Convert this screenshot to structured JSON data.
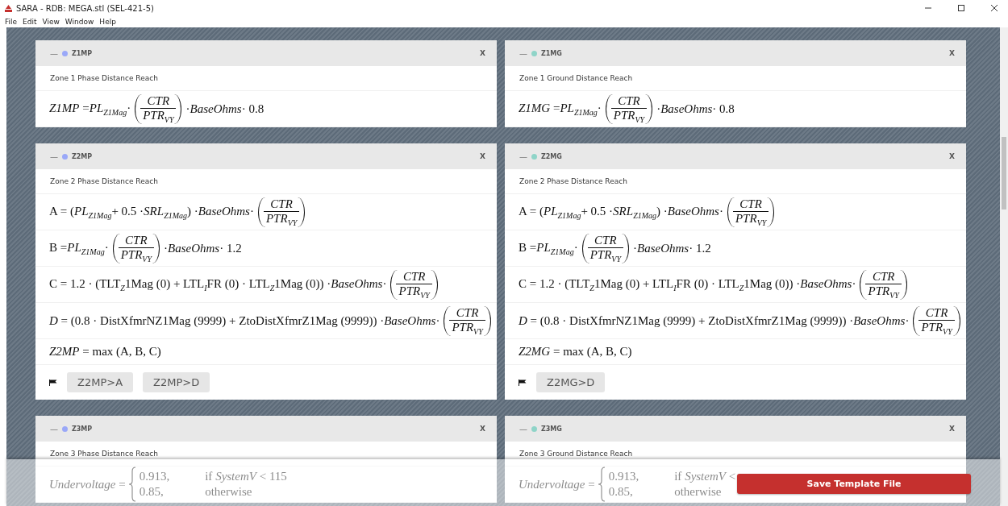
{
  "window": {
    "title": "SARA - RDB: MEGA.stl (SEL-421-5)"
  },
  "menu": [
    "File",
    "Edit",
    "View",
    "Window",
    "Help"
  ],
  "cards": [
    {
      "collapse": "—",
      "title": "Z1MP",
      "color": "#9aa8f8",
      "close": "X",
      "description": "Zone 1 Phase Distance Reach",
      "formulas": [
        [
          {
            "kind": "text",
            "text": "*Z1MP* =*PL*$_{Z1Mag}$·"
          },
          {
            "kind": "fraction",
            "num": "CTR",
            "den": "PTR$_{VY}$"
          },
          {
            "kind": "text",
            "text": "·*BaseOhms*· 0.8"
          }
        ]
      ]
    },
    {
      "collapse": "—",
      "title": "Z1MG",
      "color": "#8fd4c8",
      "close": "X",
      "description": "Zone 1 Ground Distance Reach",
      "formulas": [
        [
          {
            "kind": "text",
            "text": "*Z1MG* =*PL*$_{Z1Mag}$·"
          },
          {
            "kind": "fraction",
            "num": "CTR",
            "den": "PTR$_{VY}$"
          },
          {
            "kind": "text",
            "text": "·*BaseOhms*· 0.8"
          }
        ]
      ]
    },
    {
      "collapse": "—",
      "title": "Z2MP",
      "color": "#9aa8f8",
      "close": "X",
      "description": "Zone 2 Phase Distance Reach",
      "formulas": [
        [
          {
            "kind": "text",
            "text": "A = (*PL*$_{Z1Mag}$+ 0.5 ·*SRL*$_{Z1Mag}$) ·*BaseOhms*·"
          },
          {
            "kind": "fraction",
            "num": "CTR",
            "den": "PTR$_{VY}$"
          }
        ],
        [
          {
            "kind": "text",
            "text": "B =*PL*$_{Z1Mag}$·"
          },
          {
            "kind": "fraction",
            "num": "CTR",
            "den": "PTR$_{VY}$"
          },
          {
            "kind": "text",
            "text": "·*BaseOhms*· 1.2"
          }
        ],
        [
          {
            "kind": "text",
            "text": "C = 1.2 · (TLT$_{Z}$1Mag (0) + LTL$_{I}$FR (0) · LTL$_{Z}$1Mag (0)) ·*BaseOhms*·"
          },
          {
            "kind": "fraction",
            "num": "CTR",
            "den": "PTR$_{VY}$"
          }
        ],
        [
          {
            "kind": "text",
            "text": "*D* = (0.8 · DistXfmrNZ1Mag (9999) + ZtoDistXfmrZ1Mag (9999)) ·*BaseOhms*·"
          },
          {
            "kind": "fraction",
            "num": "CTR",
            "den": "PTR$_{VY}$"
          }
        ],
        [
          {
            "kind": "text",
            "text": "*Z2MP* = max (A, B, C)"
          }
        ]
      ],
      "flags": [
        "Z2MP>A",
        "Z2MP>D"
      ]
    },
    {
      "collapse": "—",
      "title": "Z2MG",
      "color": "#8fd4c8",
      "close": "X",
      "description": "Zone 2 Phase Distance Reach",
      "formulas": [
        [
          {
            "kind": "text",
            "text": "A = (*PL*$_{Z1Mag}$+ 0.5 ·*SRL*$_{Z1Mag}$) ·*BaseOhms*·"
          },
          {
            "kind": "fraction",
            "num": "CTR",
            "den": "PTR$_{VY}$"
          }
        ],
        [
          {
            "kind": "text",
            "text": "B =*PL*$_{Z1Mag}$·"
          },
          {
            "kind": "fraction",
            "num": "CTR",
            "den": "PTR$_{VY}$"
          },
          {
            "kind": "text",
            "text": "·*BaseOhms*· 1.2"
          }
        ],
        [
          {
            "kind": "text",
            "text": "C = 1.2 · (TLT$_{Z}$1Mag (0) + LTL$_{I}$FR (0) · LTL$_{Z}$1Mag (0)) ·*BaseOhms*·"
          },
          {
            "kind": "fraction",
            "num": "CTR",
            "den": "PTR$_{VY}$"
          }
        ],
        [
          {
            "kind": "text",
            "text": "*D* = (0.8 · DistXfmrNZ1Mag (9999) + ZtoDistXfmrZ1Mag (9999)) ·*BaseOhms*·"
          },
          {
            "kind": "fraction",
            "num": "CTR",
            "den": "PTR$_{VY}$"
          }
        ],
        [
          {
            "kind": "text",
            "text": "*Z2MG* = max (A, B, C)"
          }
        ]
      ],
      "flags": [
        "Z2MG>D"
      ]
    },
    {
      "collapse": "—",
      "title": "Z3MP",
      "color": "#9aa8f8",
      "close": "X",
      "description": "Zone 3 Phase Distance Reach",
      "formulas": [
        [
          {
            "kind": "text",
            "text": "*Undervoltage* ="
          },
          {
            "kind": "piecewise",
            "cases": [
              {
                "value": "0.913,",
                "condition": "if  *SystemV* < 115"
              },
              {
                "value": "0.85,",
                "condition": "otherwise"
              }
            ]
          }
        ]
      ]
    },
    {
      "collapse": "—",
      "title": "Z3MG",
      "color": "#8fd4c8",
      "close": "X",
      "description": "Zone 3 Ground Distance Reach",
      "formulas": [
        [
          {
            "kind": "text",
            "text": "*Undervoltage* ="
          },
          {
            "kind": "piecewise",
            "cases": [
              {
                "value": "0.913,",
                "condition": "if  *SystemV* <"
              },
              {
                "value": "0.85,",
                "condition": "otherwise"
              }
            ]
          }
        ]
      ]
    }
  ],
  "save_button": "Save Template File"
}
